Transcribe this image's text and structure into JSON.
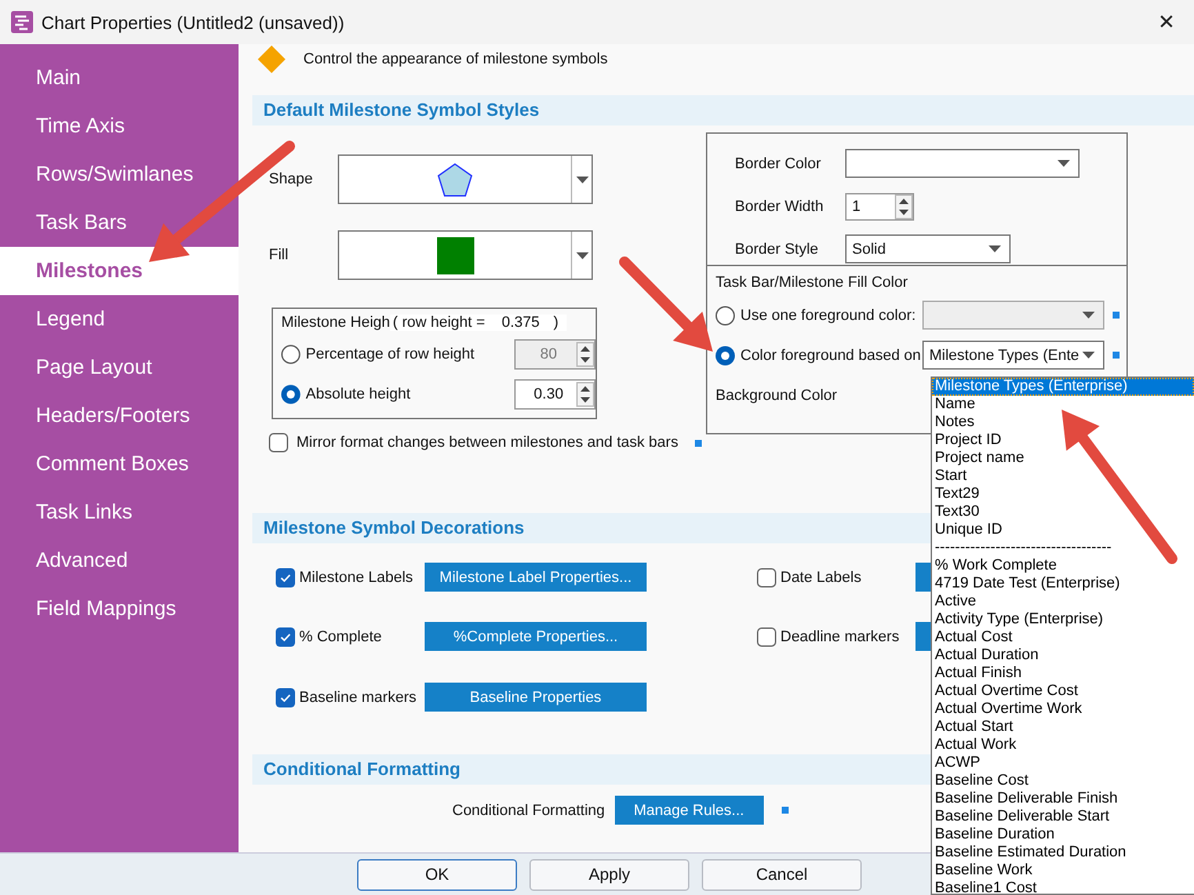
{
  "window": {
    "title": "Chart Properties (Untitled2 (unsaved))",
    "close": "✕"
  },
  "sidebar": {
    "items": [
      {
        "label": "Main",
        "selected": false
      },
      {
        "label": "Time Axis",
        "selected": false
      },
      {
        "label": "Rows/Swimlanes",
        "selected": false
      },
      {
        "label": "Task Bars",
        "selected": false
      },
      {
        "label": "Milestones",
        "selected": true
      },
      {
        "label": "Legend",
        "selected": false
      },
      {
        "label": "Page Layout",
        "selected": false
      },
      {
        "label": "Headers/Footers",
        "selected": false
      },
      {
        "label": "Comment Boxes",
        "selected": false
      },
      {
        "label": "Task Links",
        "selected": false
      },
      {
        "label": "Advanced",
        "selected": false
      },
      {
        "label": "Field Mappings",
        "selected": false
      }
    ]
  },
  "header": {
    "text": "Control the appearance of milestone symbols"
  },
  "default_styles": {
    "title": "Default Milestone Symbol Styles",
    "shape_label": "Shape",
    "fill_label": "Fill"
  },
  "milestone_height": {
    "title": "Milestone Heigh",
    "row_height_label": "( row height =",
    "row_height_value": "0.375",
    "row_height_close": ")",
    "options": [
      {
        "label": "Percentage of row height",
        "selected": false,
        "value": "80",
        "disabled": true
      },
      {
        "label": "Absolute height",
        "selected": true,
        "value": "0.30",
        "disabled": false
      }
    ]
  },
  "mirror": {
    "label": "Mirror format changes between milestones and task bars",
    "checked": false
  },
  "border": {
    "color_label": "Border Color",
    "width_label": "Border Width",
    "width_value": "1",
    "style_label": "Border Style",
    "style_value": "Solid"
  },
  "fill_color": {
    "title": "Task Bar/Milestone Fill Color",
    "options": [
      {
        "label": "Use one foreground color:",
        "selected": false,
        "disabled": true
      },
      {
        "label": "Color foreground based on",
        "selected": true,
        "disabled": false,
        "value": "Milestone Types (Ente"
      }
    ],
    "background_label": "Background Color"
  },
  "decorations": {
    "title": "Milestone Symbol Decorations",
    "items": [
      {
        "label": "Milestone Labels",
        "checked": true,
        "button": "Milestone Label Properties..."
      },
      {
        "label": "% Complete",
        "checked": true,
        "button": "%Complete Properties..."
      },
      {
        "label": "Baseline markers",
        "checked": true,
        "button": "Baseline Properties"
      },
      {
        "label": "Date Labels",
        "checked": false
      },
      {
        "label": "Deadline markers",
        "checked": false
      }
    ]
  },
  "conditional": {
    "title": "Conditional Formatting",
    "label": "Conditional Formatting",
    "button": "Manage Rules..."
  },
  "buttons": [
    "OK",
    "Apply",
    "Cancel"
  ],
  "dropdown": {
    "items": [
      {
        "text": "Milestone Types (Enterprise)",
        "selected": true
      },
      {
        "text": "Name",
        "selected": false
      },
      {
        "text": "Notes",
        "selected": false
      },
      {
        "text": "Project ID",
        "selected": false
      },
      {
        "text": "Project name",
        "selected": false
      },
      {
        "text": "Start",
        "selected": false
      },
      {
        "text": "Text29",
        "selected": false
      },
      {
        "text": "Text30",
        "selected": false
      },
      {
        "text": "Unique ID",
        "selected": false
      },
      {
        "text": "-----------------------------------",
        "selected": false
      },
      {
        "text": "% Work Complete",
        "selected": false
      },
      {
        "text": "4719 Date Test (Enterprise)",
        "selected": false
      },
      {
        "text": "Active",
        "selected": false
      },
      {
        "text": "Activity Type (Enterprise)",
        "selected": false
      },
      {
        "text": "Actual Cost",
        "selected": false
      },
      {
        "text": "Actual Duration",
        "selected": false
      },
      {
        "text": "Actual Finish",
        "selected": false
      },
      {
        "text": "Actual Overtime Cost",
        "selected": false
      },
      {
        "text": "Actual Overtime Work",
        "selected": false
      },
      {
        "text": "Actual Start",
        "selected": false
      },
      {
        "text": "Actual Work",
        "selected": false
      },
      {
        "text": "ACWP",
        "selected": false
      },
      {
        "text": "Baseline Cost",
        "selected": false
      },
      {
        "text": "Baseline Deliverable Finish",
        "selected": false
      },
      {
        "text": "Baseline Deliverable Start",
        "selected": false
      },
      {
        "text": "Baseline Duration",
        "selected": false
      },
      {
        "text": "Baseline Estimated Duration",
        "selected": false
      },
      {
        "text": "Baseline Work",
        "selected": false
      },
      {
        "text": "Baseline1 Cost",
        "selected": false
      }
    ]
  }
}
